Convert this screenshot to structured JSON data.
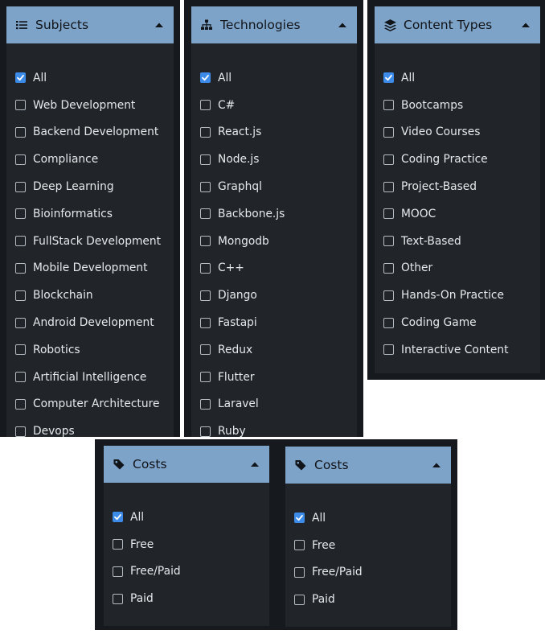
{
  "panels": [
    {
      "title": "Subjects",
      "icon": "list-icon",
      "items": [
        {
          "label": "All",
          "checked": true
        },
        {
          "label": "Web Development",
          "checked": false
        },
        {
          "label": "Backend Development",
          "checked": false
        },
        {
          "label": "Compliance",
          "checked": false
        },
        {
          "label": "Deep Learning",
          "checked": false
        },
        {
          "label": "Bioinformatics",
          "checked": false
        },
        {
          "label": "FullStack Development",
          "checked": false
        },
        {
          "label": "Mobile Development",
          "checked": false
        },
        {
          "label": "Blockchain",
          "checked": false
        },
        {
          "label": "Android Development",
          "checked": false
        },
        {
          "label": "Robotics",
          "checked": false
        },
        {
          "label": "Artificial Intelligence",
          "checked": false
        },
        {
          "label": "Computer Architecture",
          "checked": false
        },
        {
          "label": "Devops",
          "checked": false
        }
      ]
    },
    {
      "title": "Technologies",
      "icon": "sitemap-icon",
      "items": [
        {
          "label": "All",
          "checked": true
        },
        {
          "label": "C#",
          "checked": false
        },
        {
          "label": "React.js",
          "checked": false
        },
        {
          "label": "Node.js",
          "checked": false
        },
        {
          "label": "Graphql",
          "checked": false
        },
        {
          "label": "Backbone.js",
          "checked": false
        },
        {
          "label": "Mongodb",
          "checked": false
        },
        {
          "label": "C++",
          "checked": false
        },
        {
          "label": "Django",
          "checked": false
        },
        {
          "label": "Fastapi",
          "checked": false
        },
        {
          "label": "Redux",
          "checked": false
        },
        {
          "label": "Flutter",
          "checked": false
        },
        {
          "label": "Laravel",
          "checked": false
        },
        {
          "label": "Ruby",
          "checked": false
        }
      ]
    },
    {
      "title": "Content Types",
      "icon": "layers-icon",
      "items": [
        {
          "label": "All",
          "checked": true
        },
        {
          "label": "Bootcamps",
          "checked": false
        },
        {
          "label": "Video Courses",
          "checked": false
        },
        {
          "label": "Coding Practice",
          "checked": false
        },
        {
          "label": "Project-Based",
          "checked": false
        },
        {
          "label": "MOOC",
          "checked": false
        },
        {
          "label": "Text-Based",
          "checked": false
        },
        {
          "label": "Other",
          "checked": false
        },
        {
          "label": "Hands-On Practice",
          "checked": false
        },
        {
          "label": "Coding Game",
          "checked": false
        },
        {
          "label": "Interactive Content",
          "checked": false
        }
      ]
    },
    {
      "title": "Costs",
      "icon": "tag-icon",
      "items": [
        {
          "label": "All",
          "checked": true
        },
        {
          "label": "Free",
          "checked": false
        },
        {
          "label": "Free/Paid",
          "checked": false
        },
        {
          "label": "Paid",
          "checked": false
        }
      ]
    },
    {
      "title": "Costs",
      "icon": "tag-icon",
      "items": [
        {
          "label": "All",
          "checked": true
        },
        {
          "label": "Free",
          "checked": false
        },
        {
          "label": "Free/Paid",
          "checked": false
        },
        {
          "label": "Paid",
          "checked": false
        }
      ]
    }
  ],
  "colors": {
    "header_bg": "#7ea3c9",
    "panel_bg": "#212529",
    "frame_bg": "#16191d",
    "check_accent": "#3d8be8",
    "text": "#e6e8ea"
  }
}
